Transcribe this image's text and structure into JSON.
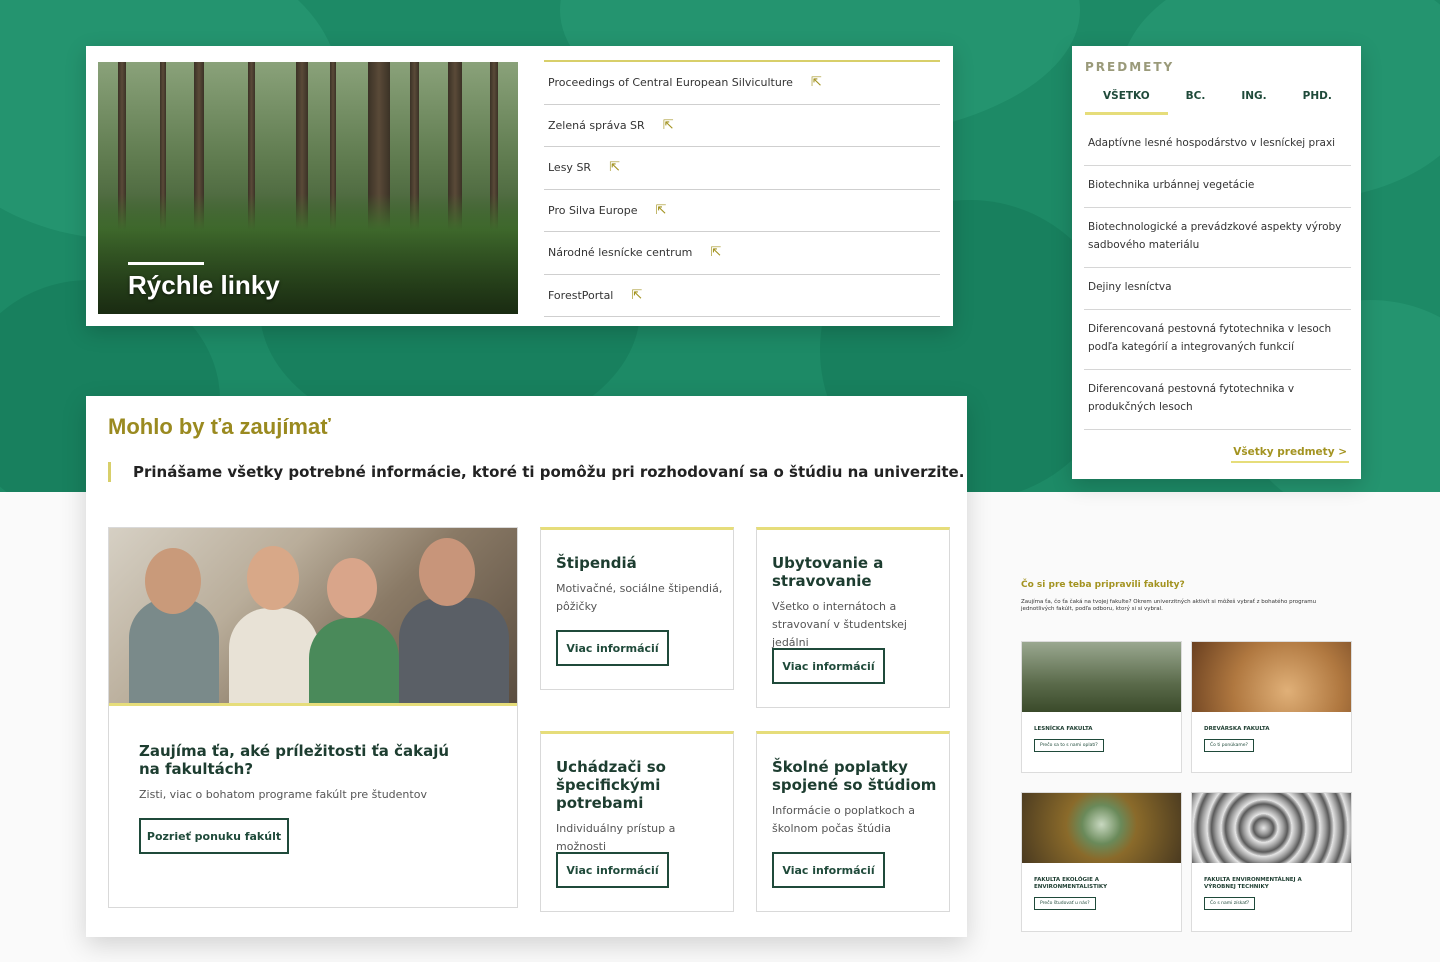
{
  "quick_links": {
    "title": "Rýchle linky",
    "items": [
      {
        "label": "Proceedings of Central European Silviculture",
        "icon": "external-link-icon"
      },
      {
        "label": "Zelená správa SR",
        "icon": "external-link-icon"
      },
      {
        "label": "Lesy SR",
        "icon": "external-link-icon"
      },
      {
        "label": "Pro Silva Europe",
        "icon": "external-link-icon"
      },
      {
        "label": "Národné lesnícke centrum",
        "icon": "external-link-icon"
      },
      {
        "label": "ForestPortal",
        "icon": "external-link-icon"
      }
    ]
  },
  "predmety": {
    "heading": "PREDMETY",
    "tabs": [
      {
        "label": "VŠETKO",
        "active": true
      },
      {
        "label": "BC.",
        "active": false
      },
      {
        "label": "ING.",
        "active": false
      },
      {
        "label": "PHD.",
        "active": false
      }
    ],
    "items": [
      "Adaptívne lesné hospodárstvo v lesníckej praxi",
      "Biotechnika urbánnej vegetácie",
      "Biotechnologické a prevádzkové aspekty výroby sadbového materiálu",
      "Dejiny lesníctva",
      "Diferencovaná pestovná fytotechnika v lesoch podľa kategórií a integrovaných funkcií",
      "Diferencovaná pestovná fytotechnika v produkčných lesoch"
    ],
    "all_link": "Všetky predmety >"
  },
  "mohlo": {
    "title": "Mohlo by ťa zaujímať",
    "subtitle": "Prinášame všetky potrebné informácie, ktoré ti pomôžu pri rozhodovaní sa o štúdiu na univerzite.",
    "featured": {
      "title": "Zaujíma ťa, aké príležitosti ťa čakajú na fakultách?",
      "desc": "Zisti, viac o bohatom programe fakúlt pre študentov",
      "button": "Pozrieť ponuku fakúlt"
    },
    "cards": [
      {
        "title": "Štipendiá",
        "desc": "Motivačné, sociálne štipendiá, pôžičky",
        "button": "Viac informácií"
      },
      {
        "title": "Ubytovanie a stravovanie",
        "desc": "Všetko o internátoch a stravovaní v študentskej jedálni",
        "button": "Viac informácií"
      },
      {
        "title": "Uchádzači so špecifickými potrebami",
        "desc": "Individuálny prístup a možnosti",
        "button": "Viac informácií"
      },
      {
        "title": "Školné poplatky spojené so štúdiom",
        "desc": "Informácie o poplatkoch a školnom počas štúdia",
        "button": "Viac informácií"
      }
    ]
  },
  "fakulty": {
    "title": "Čo si pre teba pripravili fakulty?",
    "desc": "Zaujíma ťa, čo ťa čaká na tvojej fakulte? Okrem univerzitných aktivít si môžeš vybrať z bohatého programu jednotlivých fakúlt, podľa odboru, ktorý si si vybral.",
    "items": [
      {
        "name": "LESNÍCKA FAKULTA",
        "button": "Prečo sa to s nami oplatí?"
      },
      {
        "name": "DREVÁRSKA FAKULTA",
        "button": "Čo ti ponúkame?"
      },
      {
        "name": "FAKULTA EKOLÓGIE A ENVIRONMENTALISTIKY",
        "button": "Prečo študovať u nás?"
      },
      {
        "name": "FAKULTA ENVIRONMENTÁLNEJ A VÝROBNEJ TECHNIKY",
        "button": "Čo s nami získať?"
      }
    ]
  },
  "colors": {
    "green": "#1d8a66",
    "accent": "#a39320",
    "dark": "#1f4a3a",
    "line": "#e6dd7a"
  }
}
